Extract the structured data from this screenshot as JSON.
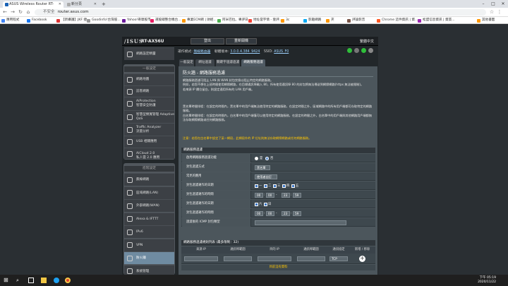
{
  "browser": {
    "tabs": [
      {
        "title": "ASUS Wireless Router RT-AX5…",
        "active": true
      },
      {
        "title": "新分頁",
        "active": false
      }
    ],
    "new_tab": "+",
    "address": {
      "security": "不安全",
      "url": "router.asus.com"
    },
    "bookmarks": [
      "應用程式",
      "Facebook",
      "【新攝護】JKF 捷...",
      "Goodinfo!台灣股...",
      "Yahoo!奇摩股市",
      "選股總整合機台...",
      "專業ECM網 | 財經...",
      "阿米巴拉。專評日...",
      "地址當字情 - 壹評...",
      "3c",
      "影趣網路",
      "夾",
      "評論影音",
      "Chrome 這件資訊 | 資...",
      "松盟信息資訊 | 資質...",
      "其他書籤"
    ]
  },
  "router": {
    "logo": "/ISUS",
    "model": "RT-AX56U",
    "logout": "登出",
    "reboot": "重新開機",
    "language": "繁體中文",
    "status": {
      "mode_label": "運作模式:",
      "mode_value": "無線路由器",
      "fw_label": "韌體版本:",
      "fw_value": "3.0.0.4.384_9424",
      "ssid_label": "SSID:",
      "ssid_value": "ASUS_F0"
    },
    "sidebar": {
      "quick": "網路設定精靈",
      "general_head": "一般設定",
      "general": [
        "網路地圖",
        "訪客網路",
        "AiProtection\n智慧安全防護",
        "智慧型頻寬管理 Adaptive QoS",
        "Traffic Analyzer\n流量分析",
        "USB 相關應用",
        "AiCloud 2.0\n私人雲 2.0 應用"
      ],
      "advanced_head": "進階設定",
      "advanced": [
        "無線網路",
        "區域網路(LAN)",
        "外部網路(WAN)",
        "Alexa & IFTTT",
        "IPv6",
        "VPN",
        "防火牆",
        "系統管理"
      ]
    },
    "subtabs": [
      "一般設定",
      "網址過濾",
      "關鍵字過濾過濾",
      "網路服務過濾"
    ],
    "page_title": "防火牆 - 網路服務過濾",
    "desc": [
      "網路服務過濾可阻止 LAN 與 WAN 封包交換以阻止特定的網路服務。",
      "例如，若您不想在上班時間使用網際網路，在目標通訊埠輸入 80，所有使用通訊埠 80 的封包將無法傳送到網際網路(https 無法被限制)。",
      "若來源 IP 欄位留白，則設定適用所有的 LAN 用戶端。"
    ],
    "desc2": [
      "黑名單時間排程：在設定的時間內，黑名單中的用戶端無法使用特定的網路服務，在設定時間之外，區域網路中的所有用戶端都可存取特定的網路服務。",
      "白名單時間排程：在設定的時間內，白名單中的用戶端僅可以使用特定的網路服務，在設定的時間之外，白名單中的用戶端與其他網路用戶端都無法存取網際網路或任何網路服務。"
    ],
    "warning": "注意：若您在白名單中設定了某一網段，此網段外的 IP 位址則無法存取網際網路或任何網路服務。",
    "section1": "網路服務過濾",
    "rows": {
      "enable": {
        "label": "啟用網路服務過濾功能",
        "yes": "是",
        "no": "否"
      },
      "filter_type": {
        "label": "封包過濾方式",
        "value": "黑名單"
      },
      "common": {
        "label": "常見的應用",
        "value": "使用者自訂"
      },
      "day_label": "封包過濾運作的日期",
      "days": [
        "一",
        "二",
        "三",
        "四",
        "五"
      ],
      "time_label": "封包過濾運作的時間",
      "time1": [
        "00",
        "00",
        "23",
        "59"
      ],
      "day2_label": "封包過濾運作的日期",
      "days2": [
        "六",
        "日"
      ],
      "time2_label": "封包過濾運作的時間",
      "time2": [
        "00",
        "00",
        "23",
        "59"
      ],
      "icmp_label": "過濾後的 ICMP 封包類型"
    },
    "section2": "網路服務過濾規則列表 (最多限制：32)",
    "table_cols": [
      "來源 IP",
      "通訊埠範圍",
      "目的 IP",
      "通訊埠範圍",
      "通訊協定",
      "新增 / 移除"
    ],
    "protocol": "TCP",
    "nodata": "目前沒有資料"
  },
  "taskbar": {
    "time": "下午 05:19",
    "date": "2020/11/22"
  }
}
